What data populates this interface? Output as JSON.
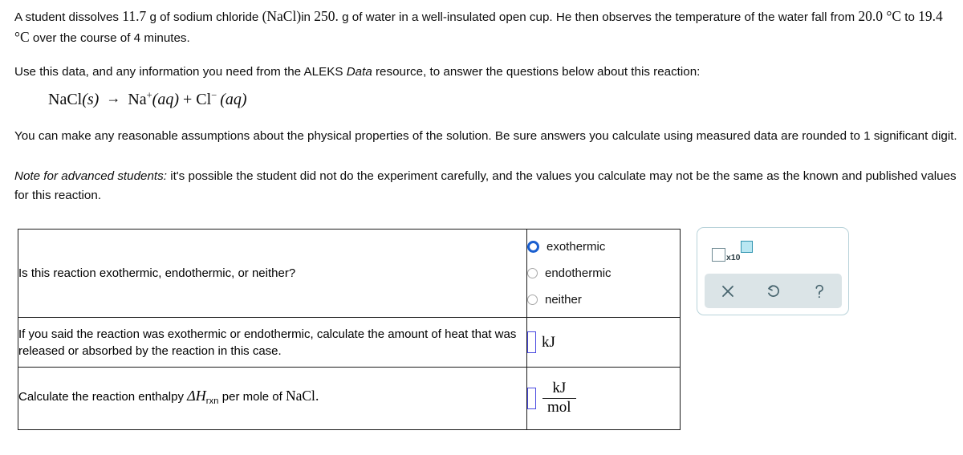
{
  "problem": {
    "intro_sentence_parts": {
      "p1": "A student dissolves ",
      "mass": "11.7",
      "p2": " g of sodium chloride ",
      "formula": "(NaCl)",
      "p3": "in ",
      "water_mass": "250.",
      "p4": " g of water in a well-insulated open cup. He then observes the temperature of the water fall from ",
      "temp_start": "20.0 °C",
      "p5": " to ",
      "temp_end": "19.4 °C",
      "p6": " over the course of 4 minutes."
    },
    "resource_line": {
      "p1": "Use this data, and any information you need from the ALEKS ",
      "emphasis": "Data",
      "p2": " resource, to answer the questions below about this reaction:"
    },
    "equation": {
      "reactant": "NaCl",
      "reactant_state": "(s)",
      "arrow": "→",
      "product1": "Na",
      "product1_charge": "+",
      "product1_state": "(aq)",
      "plus": "+",
      "product2": "Cl",
      "product2_charge": "−",
      "product2_state": "(aq)"
    },
    "assumptions": "You can make any reasonable assumptions about the physical properties of the solution. Be sure answers you calculate using measured data are rounded to 1 significant digit.",
    "note": {
      "label": "Note for advanced students:",
      "text": " it's possible the student did not do the experiment carefully, and the values you calculate may not be the same as the known and published values for this reaction."
    }
  },
  "table": {
    "rows": [
      {
        "question": "Is this reaction exothermic, endothermic, or neither?",
        "answer_type": "radio",
        "options": [
          {
            "label": "exothermic",
            "selected": true
          },
          {
            "label": "endothermic",
            "selected": false
          },
          {
            "label": "neither",
            "selected": false
          }
        ]
      },
      {
        "question": "If you said the reaction was exothermic or endothermic, calculate the amount of heat that was released or absorbed by the reaction in this case.",
        "answer_type": "input-unit",
        "input_value": "",
        "unit": "kJ"
      },
      {
        "question_parts": {
          "p1": "Calculate the reaction enthalpy ",
          "symbol": "ΔH",
          "subscript": "rxn",
          "p2": " per mole of ",
          "formula": "NaCl",
          "p3": "."
        },
        "answer_type": "input-fraction",
        "input_value": "",
        "unit_numerator": "kJ",
        "unit_denominator": "mol"
      }
    ]
  },
  "toolbar": {
    "sci_notation": {
      "multiplier_label": "x10"
    },
    "buttons": [
      {
        "name": "clear",
        "glyph": "×"
      },
      {
        "name": "undo",
        "glyph": "↺"
      },
      {
        "name": "help",
        "glyph": "?"
      }
    ]
  },
  "colors": {
    "radio_selected": "#1a5fd0",
    "input_border": "#4a4ae0",
    "widget_border": "#b9d3da",
    "toolbar_band": "#dbe4e7",
    "toolbar_icon": "#47646e",
    "exponent_fill": "#b9e7f2",
    "exponent_border": "#2e93b0"
  }
}
